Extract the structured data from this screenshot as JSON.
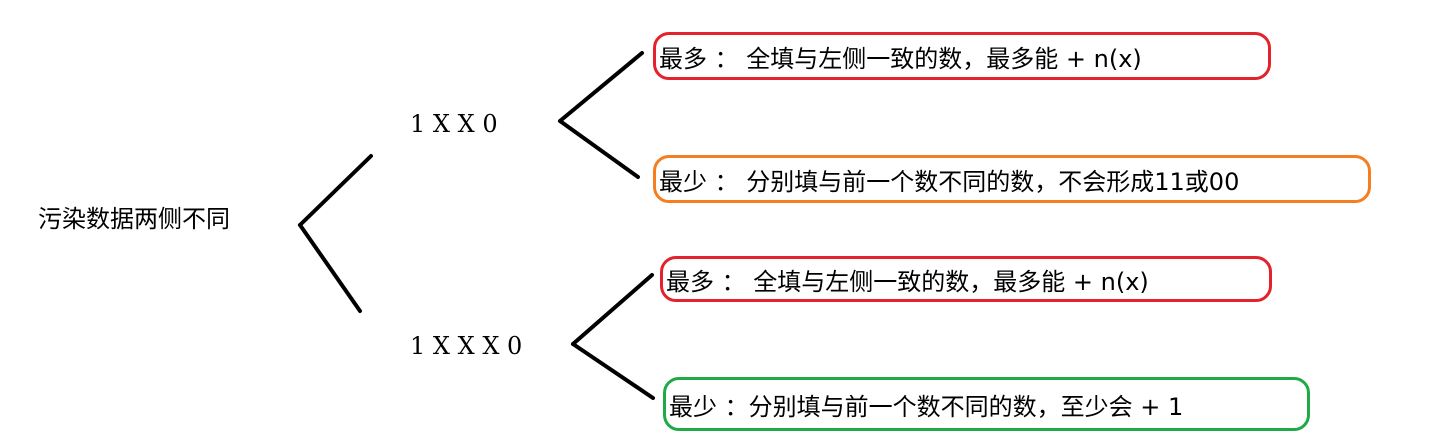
{
  "colors": {
    "line": "#000000",
    "red": "#e3222b",
    "orange": "#f47e20",
    "green": "#1faa46"
  },
  "root": {
    "label": "污染数据两侧不同"
  },
  "cases": [
    {
      "sequence": "1 X X 0",
      "outcomes": [
        {
          "label": "最多 ： 全填与左侧一致的数，最多能 + n(x)",
          "color": "red"
        },
        {
          "label": "最少 ： 分别填与前一个数不同的数，不会形成11或00",
          "color": "orange"
        }
      ]
    },
    {
      "sequence": "1 X X X 0",
      "outcomes": [
        {
          "label": "最多 ： 全填与左侧一致的数，最多能 + n(x)",
          "color": "red"
        },
        {
          "label": "最少 ：分别填与前一个数不同的数，至少会 + 1",
          "color": "green"
        }
      ]
    }
  ]
}
